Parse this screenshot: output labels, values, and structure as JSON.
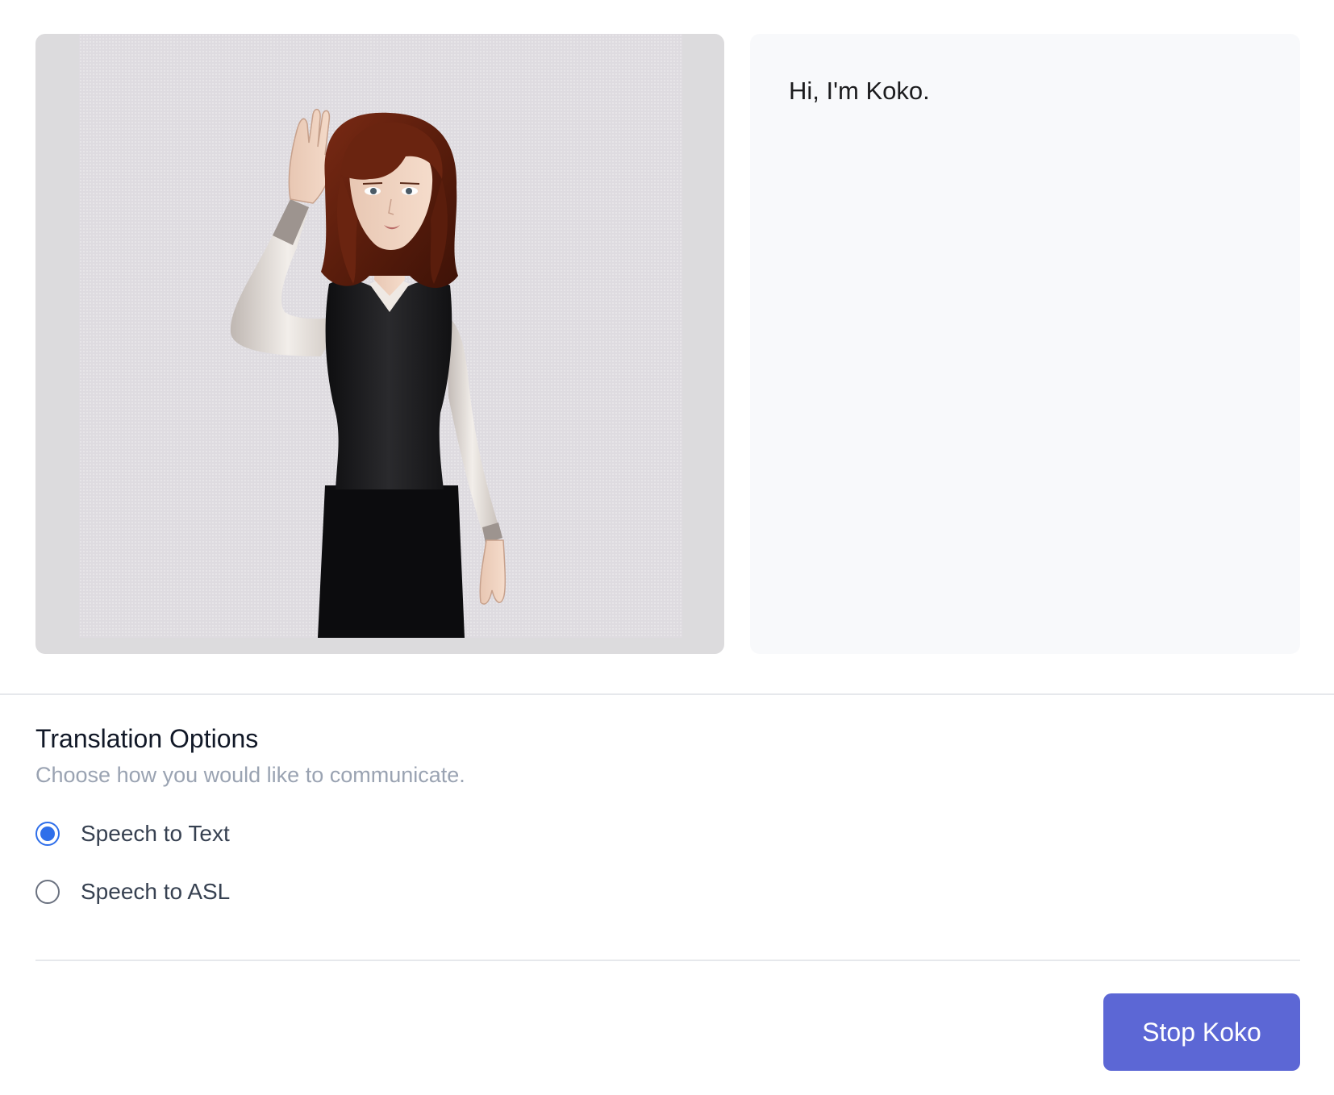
{
  "avatar": {
    "name": "koko-avatar",
    "background": "#dcdbdd"
  },
  "transcript": {
    "text": "Hi, I'm Koko."
  },
  "options": {
    "title": "Translation Options",
    "subtitle": "Choose how you would like to communicate.",
    "items": [
      {
        "label": "Speech to Text",
        "selected": true
      },
      {
        "label": "Speech to ASL",
        "selected": false
      }
    ]
  },
  "actions": {
    "stop_label": "Stop Koko"
  },
  "colors": {
    "accent": "#2f6fea",
    "button": "#5c67d5",
    "subtitle": "#9aa3b2"
  }
}
